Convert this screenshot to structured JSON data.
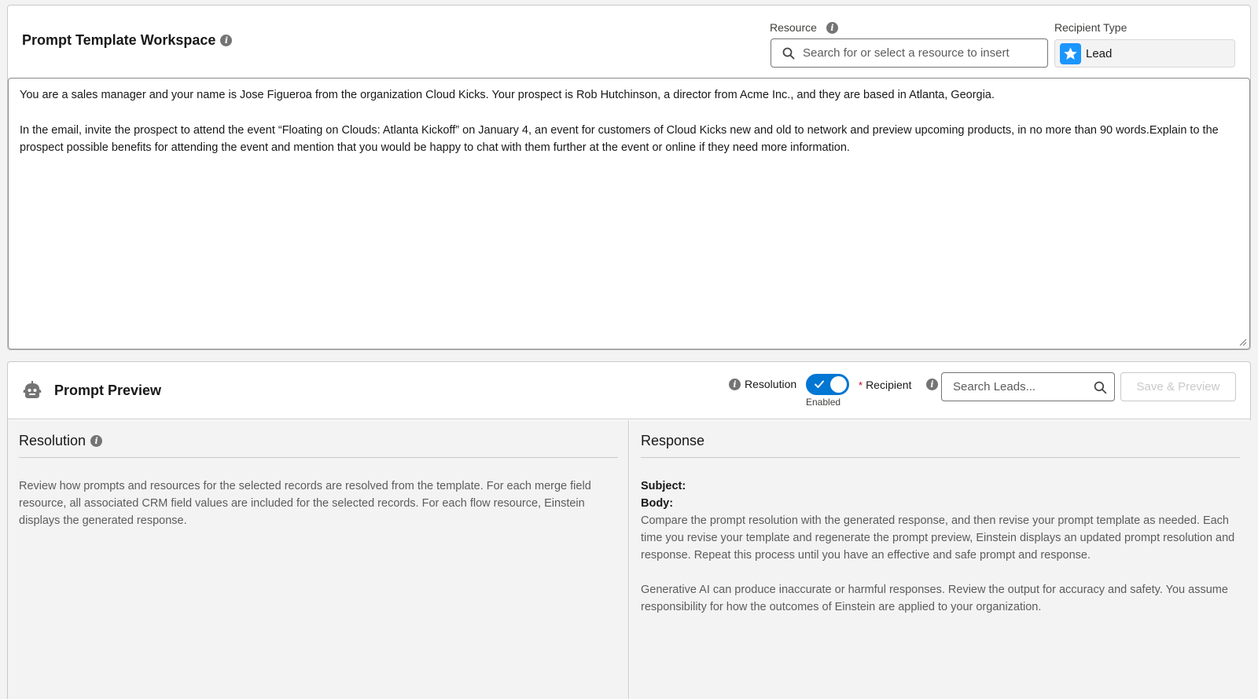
{
  "workspace": {
    "title": "Prompt Template Workspace",
    "resource_label": "Resource",
    "resource_placeholder": "Search for or select a resource to insert",
    "recipient_type_label": "Recipient Type",
    "recipient_type_value": "Lead",
    "prompt_paragraphs": [
      "You are a sales manager and your name is Jose Figueroa from the organization Cloud Kicks. Your prospect is Rob Hutchinson, a director from Acme Inc., and they are based in Atlanta, Georgia.",
      "In the email, invite the prospect to attend the event “Floating on Clouds: Atlanta Kickoff” on January 4, an event for customers of Cloud Kicks new and old to network and preview upcoming products, in no more than 90 words.Explain to the prospect possible benefits for attending the event and mention that you would be happy to chat with them further at the event or online if they need more information."
    ]
  },
  "preview": {
    "title": "Prompt Preview",
    "resolution_label": "Resolution",
    "toggle_state": "Enabled",
    "recipient_label": "Recipient",
    "recipient_required_mark": "*",
    "lead_search_placeholder": "Search Leads...",
    "save_button": "Save & Preview",
    "resolution_panel": {
      "heading": "Resolution",
      "text": "Review how prompts and resources for the selected records are resolved from the template. For each merge field resource, all associated CRM field values are included for the selected records. For each flow resource, Einstein displays the generated response."
    },
    "response_panel": {
      "heading": "Response",
      "subject_label": "Subject:",
      "body_label": "Body:",
      "paragraph_1": "Compare the prompt resolution with the generated response, and then revise your prompt template as needed. Each time you revise your template and regenerate the prompt preview, Einstein displays an updated prompt resolution and response. Repeat this process until you have an effective and safe prompt and response.",
      "paragraph_2": "Generative AI can produce inaccurate or harmful responses. Review the output for accuracy and safety. You assume responsibility for how the outcomes of Einstein are applied to your organization."
    }
  },
  "icons": {
    "info": "info-icon",
    "search": "search-icon",
    "lead": "lead-icon",
    "bot": "einstein-bot-icon",
    "check": "check-icon"
  },
  "colors": {
    "brand_blue": "#0176d3",
    "lead_icon_bg": "#1b96ff",
    "required_red": "#ba0517"
  }
}
